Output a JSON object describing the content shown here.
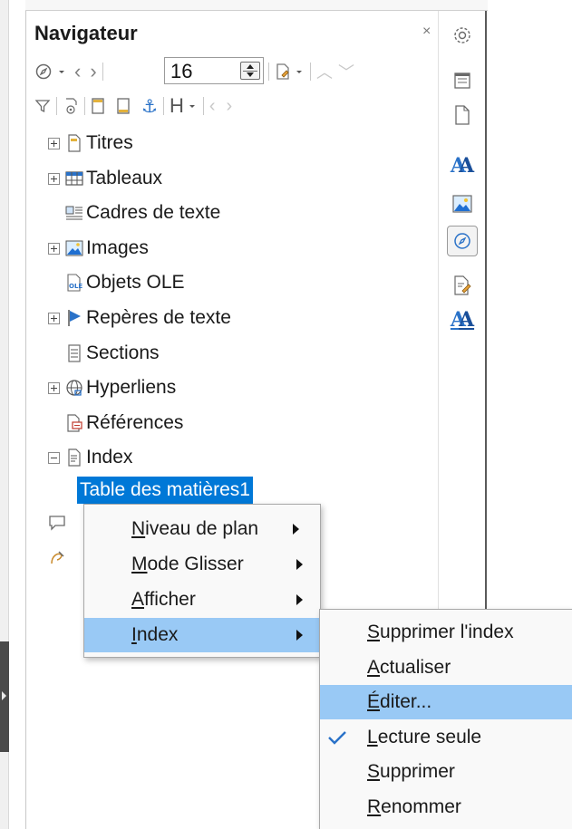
{
  "navigator": {
    "title": "Navigateur",
    "close_glyph": "×",
    "page_number": "16"
  },
  "tree": {
    "items": [
      {
        "label": "Titres",
        "icon": "headings-icon",
        "expander": "plus"
      },
      {
        "label": "Tableaux",
        "icon": "table-icon",
        "expander": "plus"
      },
      {
        "label": "Cadres de texte",
        "icon": "text-frame-icon",
        "expander": "none"
      },
      {
        "label": "Images",
        "icon": "image-icon",
        "expander": "plus"
      },
      {
        "label": "Objets OLE",
        "icon": "ole-object-icon",
        "expander": "none"
      },
      {
        "label": "Repères de texte",
        "icon": "bookmark-flag-icon",
        "expander": "plus"
      },
      {
        "label": "Sections",
        "icon": "section-icon",
        "expander": "none"
      },
      {
        "label": "Hyperliens",
        "icon": "hyperlink-globe-icon",
        "expander": "plus"
      },
      {
        "label": "Références",
        "icon": "reference-icon",
        "expander": "none"
      },
      {
        "label": "Index",
        "icon": "index-icon",
        "expander": "minus"
      }
    ],
    "selected_child": "Table des matières1"
  },
  "context_menu": {
    "items": [
      {
        "prefix": "",
        "accel": "N",
        "rest": "iveau de plan",
        "has_submenu": true
      },
      {
        "prefix": "",
        "accel": "M",
        "rest": "ode Glisser",
        "has_submenu": true
      },
      {
        "prefix": "",
        "accel": "A",
        "rest": "fficher",
        "has_submenu": true
      },
      {
        "prefix": "",
        "accel": "I",
        "rest": "ndex",
        "has_submenu": true,
        "highlighted": true
      }
    ]
  },
  "index_submenu": {
    "items": [
      {
        "accel": "S",
        "rest": "upprimer l'index"
      },
      {
        "accel": "A",
        "rest": "ctualiser"
      },
      {
        "accel": "É",
        "rest": "diter...",
        "highlighted": true
      },
      {
        "accel": "L",
        "rest": "ecture seule",
        "checked": true
      },
      {
        "accel": "S",
        "rest": "upprimer"
      },
      {
        "accel": "R",
        "rest": "enommer"
      }
    ]
  },
  "colors": {
    "selection": "#0078d7",
    "menu_highlight": "#99c9f5",
    "icon_blue": "#1f6fd1"
  }
}
